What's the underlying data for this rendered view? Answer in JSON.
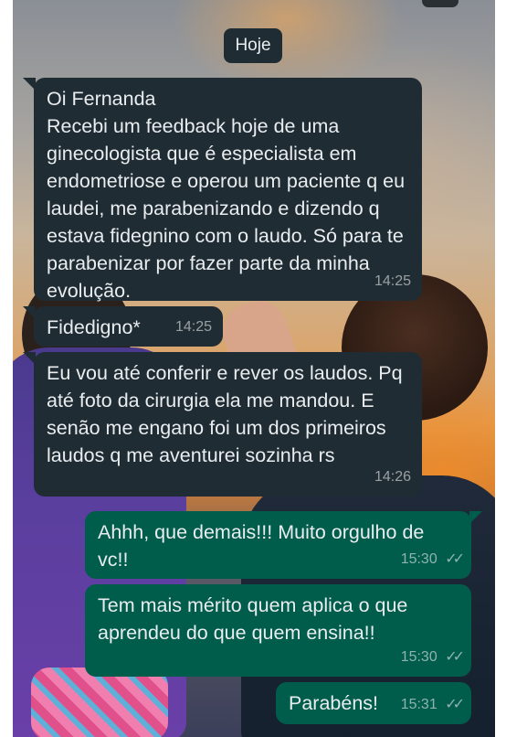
{
  "date_chip": "Hoje",
  "messages": [
    {
      "direction": "in",
      "text": "Oi Fernanda\nRecebi um feedback hoje de uma ginecologista que é especialista em endometriose e operou um paciente q eu laudei, me parabenizando e dizendo q estava fidegnino com o laudo. Só para te parabenizar por fazer parte da minha evolução.",
      "time": "14:25"
    },
    {
      "direction": "in",
      "text": "Fidedigno*",
      "time": "14:25"
    },
    {
      "direction": "in",
      "text": "Eu vou até conferir e rever os laudos. Pq até foto da cirurgia ela me mandou. E senão me engano foi um dos primeiros laudos q me aventurei sozinha rs",
      "time": "14:26"
    },
    {
      "direction": "out",
      "text": "Ahhh, que demais!!! Muito orgulho de vc!!",
      "time": "15:30",
      "status": "✓✓"
    },
    {
      "direction": "out",
      "text": "Tem mais mérito quem aplica o que aprendeu do que quem ensina!!",
      "time": "15:30",
      "status": "✓✓"
    },
    {
      "direction": "out",
      "text": "Parabéns!",
      "time": "15:31",
      "status": "✓✓"
    }
  ],
  "colors": {
    "incoming_bubble": "#202c33",
    "outgoing_bubble": "#005c4b",
    "text": "#e9edef"
  }
}
